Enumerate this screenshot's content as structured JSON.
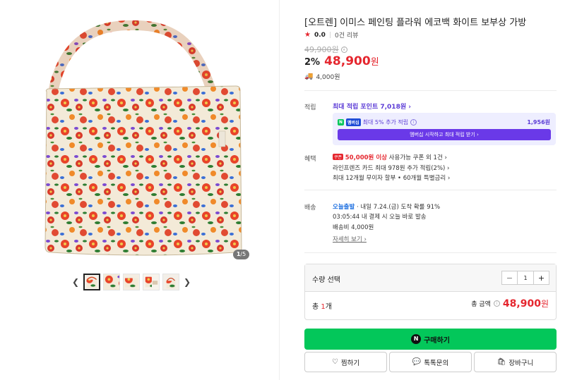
{
  "product": {
    "title": "[오트렌] 이미스 페인팅 플라워 에코백 화이트 보부상 가방",
    "rating": "0.0",
    "reviews": "0건 리뷰",
    "original_price": "49,900원",
    "discount": "2%",
    "price": "48,900",
    "price_unit": "원",
    "shipping_fee": "4,000원"
  },
  "gallery": {
    "current": "1",
    "total": "/5",
    "thumbnail_count": 5
  },
  "points": {
    "label": "적립",
    "max_points": "최대 적립 포인트 7,018원 ›",
    "badge_n": "N",
    "badge_plus": "멤버십",
    "extra": "최대 5% 추가 적립",
    "extra_amount": "1,956원",
    "cta": "멤버십 시작하고 최대 적립 받기 ›"
  },
  "benefits": {
    "label": "혜택",
    "coupon_badge": "쿠폰",
    "coupon_amount": "50,000원 이상",
    "coupon_text": " 사용가능 쿠폰 외 1건 ›",
    "card": "라인프렌즈 카드 최대 978원 추가 적립(2%) ›",
    "installment": "최대 12개월 무이자 할부 • 60개월 특별금리 ›"
  },
  "delivery": {
    "label": "배송",
    "today": "오늘출발",
    "arrival": " · 내일 7.24.(금) 도착 확률 91%",
    "countdown": "03:05:44  내 결제 시 오늘 바로 발송",
    "fee": "배송비 4,000원",
    "detail_link": "자세히 보기 ›"
  },
  "quantity": {
    "label": "수량 선택",
    "minus": "−",
    "value": "1",
    "plus": "+",
    "total_label_prefix": "총 ",
    "total_count": "1",
    "total_label_suffix": "개",
    "total_amount_label": "총 금액",
    "total_price": "48,900",
    "total_unit": "원"
  },
  "actions": {
    "buy_icon": "N",
    "buy": "구매하기",
    "wish": "찜하기",
    "talk": "톡톡문의",
    "cart": "장바구니"
  },
  "colors": {
    "accent_red": "#e5262e",
    "naver_green": "#03c75a",
    "membership_purple": "#6a39e8"
  }
}
